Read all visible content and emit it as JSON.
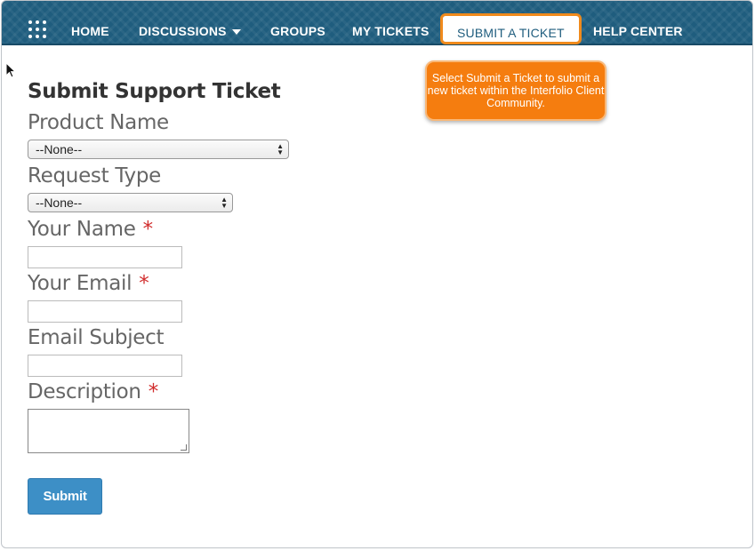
{
  "nav": {
    "items": [
      {
        "label": "HOME"
      },
      {
        "label": "DISCUSSIONS"
      },
      {
        "label": "GROUPS"
      },
      {
        "label": "MY TICKETS"
      },
      {
        "label": "SUBMIT A TICKET"
      },
      {
        "label": "HELP CENTER"
      }
    ],
    "active_item": "SUBMIT A TICKET"
  },
  "callout": {
    "text": "Select Submit a Ticket to submit a new ticket within the Interfolio Client Community."
  },
  "form": {
    "title": "Submit Support Ticket",
    "product_name": {
      "label": "Product Name",
      "value": "--None--"
    },
    "request_type": {
      "label": "Request Type",
      "value": "--None--"
    },
    "your_name": {
      "label": "Your Name",
      "required_mark": "*",
      "value": ""
    },
    "your_email": {
      "label": "Your Email",
      "required_mark": "*",
      "value": ""
    },
    "email_subject": {
      "label": "Email Subject",
      "value": ""
    },
    "description": {
      "label": "Description",
      "required_mark": "*",
      "value": ""
    },
    "submit_label": "Submit"
  },
  "colors": {
    "nav_bg": "#1f5d7e",
    "highlight": "#f08a1c",
    "callout_bg": "#f57d0f",
    "required": "#d12c2c",
    "button": "#3d8fc6"
  }
}
